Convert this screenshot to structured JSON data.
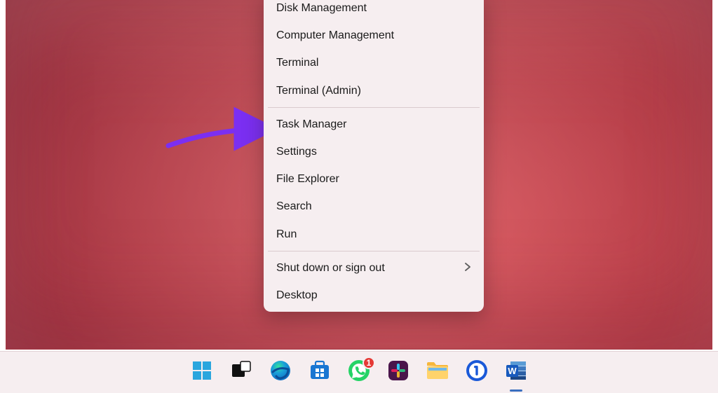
{
  "menu": {
    "group1": [
      {
        "label": "Disk Management"
      },
      {
        "label": "Computer Management"
      },
      {
        "label": "Terminal"
      },
      {
        "label": "Terminal (Admin)"
      }
    ],
    "group2": [
      {
        "label": "Task Manager"
      },
      {
        "label": "Settings"
      },
      {
        "label": "File Explorer"
      },
      {
        "label": "Search"
      },
      {
        "label": "Run"
      }
    ],
    "group3": [
      {
        "label": "Shut down or sign out",
        "submenu": true
      },
      {
        "label": "Desktop"
      }
    ]
  },
  "taskbar": {
    "icons": [
      {
        "name": "start-icon"
      },
      {
        "name": "task-view-icon"
      },
      {
        "name": "edge-icon"
      },
      {
        "name": "microsoft-store-icon"
      },
      {
        "name": "whatsapp-icon",
        "badge": "1"
      },
      {
        "name": "slack-icon"
      },
      {
        "name": "file-explorer-icon"
      },
      {
        "name": "onepassword-icon"
      },
      {
        "name": "word-icon",
        "active": true
      }
    ]
  },
  "colors": {
    "annotation_arrow": "#7b2ff2",
    "menu_bg": "#f6eef0",
    "taskbar_bg": "#f6eef0"
  }
}
